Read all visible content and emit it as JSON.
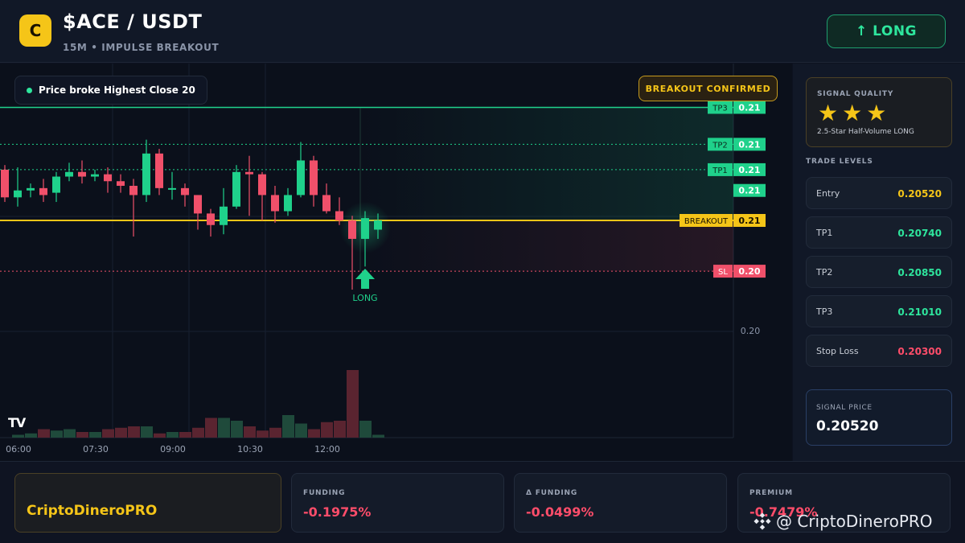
{
  "header": {
    "coin_letter": "C",
    "title": "$ACE / USDT",
    "subtitle": "15M • IMPULSE BREAKOUT",
    "long_button": "↑ LONG"
  },
  "chart": {
    "info_pill": "Price broke Highest Close 20",
    "breakout_badge": "BREAKOUT CONFIRMED",
    "tv_logo": "TV",
    "signal_label": "LONG",
    "price_axis_label": "0.20",
    "time_labels": [
      "06:00",
      "07:30",
      "09:00",
      "10:30",
      "12:00"
    ],
    "level_tags": [
      {
        "name": "TP3",
        "value": "0.21"
      },
      {
        "name": "TP2",
        "value": "0.21"
      },
      {
        "name": "TP1",
        "value": "0.21"
      },
      {
        "name": "",
        "value": "0.21"
      },
      {
        "name": "BREAKOUT",
        "value": "0.21"
      },
      {
        "name": "SL",
        "value": "0.20"
      }
    ],
    "colors": {
      "up": "#1fd18b",
      "down": "#f0506a",
      "breakout": "#f5c518",
      "tp": "#1fd18b",
      "sl": "#f0506a"
    }
  },
  "chart_data": {
    "type": "candlestick",
    "x": [
      "05:45",
      "06:00",
      "06:15",
      "06:30",
      "06:45",
      "07:00",
      "07:15",
      "07:30",
      "07:45",
      "08:00",
      "08:15",
      "08:30",
      "08:45",
      "09:00",
      "09:15",
      "09:30",
      "09:45",
      "10:00",
      "10:15",
      "10:30",
      "10:45",
      "11:00",
      "11:15",
      "11:30",
      "11:45",
      "12:00",
      "12:15",
      "12:30",
      "12:45",
      "13:00"
    ],
    "open": [
      0.2074,
      0.2062,
      0.2065,
      0.2066,
      0.2064,
      0.2071,
      0.2073,
      0.2071,
      0.2072,
      0.2069,
      0.2067,
      0.2063,
      0.2081,
      0.2066,
      0.2066,
      0.2063,
      0.2055,
      0.205,
      0.2058,
      0.2073,
      0.2072,
      0.2063,
      0.2056,
      0.2063,
      0.2078,
      0.2063,
      0.2056,
      0.2052,
      0.2044,
      0.2048
    ],
    "high": [
      0.2076,
      0.2075,
      0.2068,
      0.207,
      0.2073,
      0.2077,
      0.2078,
      0.2074,
      0.2075,
      0.2072,
      0.207,
      0.2087,
      0.2083,
      0.2073,
      0.2068,
      0.2063,
      0.2057,
      0.2066,
      0.2076,
      0.208,
      0.2073,
      0.2067,
      0.2066,
      0.2086,
      0.208,
      0.2068,
      0.2062,
      0.2054,
      0.2056,
      0.2055
    ],
    "low": [
      0.206,
      0.2058,
      0.2062,
      0.206,
      0.206,
      0.2069,
      0.2068,
      0.2069,
      0.2064,
      0.2064,
      0.2045,
      0.206,
      0.2063,
      0.2061,
      0.2058,
      0.2048,
      0.2045,
      0.2046,
      0.2057,
      0.2054,
      0.2052,
      0.2051,
      0.2054,
      0.2062,
      0.2058,
      0.2055,
      0.205,
      0.2022,
      0.2032,
      0.2044
    ],
    "close": [
      0.2062,
      0.2065,
      0.2066,
      0.2063,
      0.2071,
      0.2073,
      0.2071,
      0.2072,
      0.2069,
      0.2067,
      0.2063,
      0.2081,
      0.2066,
      0.2066,
      0.2063,
      0.2055,
      0.205,
      0.2058,
      0.2073,
      0.2072,
      0.2063,
      0.2056,
      0.2063,
      0.2078,
      0.2063,
      0.2056,
      0.2052,
      0.2044,
      0.2053,
      0.2052
    ],
    "volume": [
      0,
      2,
      3,
      6,
      5,
      6,
      4,
      4,
      6,
      7,
      8,
      8,
      3,
      4,
      4,
      7,
      14,
      14,
      12,
      8,
      5,
      7,
      16,
      10,
      6,
      11,
      12,
      48,
      12,
      2
    ],
    "levels": {
      "tp3": 0.2101,
      "tp2": 0.2085,
      "tp1": 0.2074,
      "breakout": 0.2052,
      "sl": 0.203
    },
    "ylim": [
      0.1984,
      0.212
    ],
    "grid": true
  },
  "right_panel": {
    "quality_title": "SIGNAL QUALITY",
    "stars": "★★★",
    "quality_desc": "2.5-Star Half-Volume LONG",
    "levels_title": "TRADE LEVELS",
    "levels": [
      {
        "name": "Entry",
        "value": "0.20520",
        "color": "#f5c518"
      },
      {
        "name": "TP1",
        "value": "0.20740",
        "color": "#2ee59d"
      },
      {
        "name": "TP2",
        "value": "0.20850",
        "color": "#2ee59d"
      },
      {
        "name": "TP3",
        "value": "0.21010",
        "color": "#2ee59d"
      },
      {
        "name": "Stop Loss",
        "value": "0.20300",
        "color": "#ff4d6a"
      }
    ],
    "signal_price_label": "SIGNAL PRICE",
    "signal_price": "0.20520"
  },
  "bottom": {
    "brand": "CriptoDineroPRO",
    "stats": [
      {
        "label": "FUNDING",
        "value": "-0.1975%"
      },
      {
        "label": "Δ FUNDING",
        "value": "-0.0499%"
      },
      {
        "label": "PREMIUM",
        "value": "-0.7479%"
      }
    ],
    "watermark": "@ CriptoDineroPRO"
  }
}
